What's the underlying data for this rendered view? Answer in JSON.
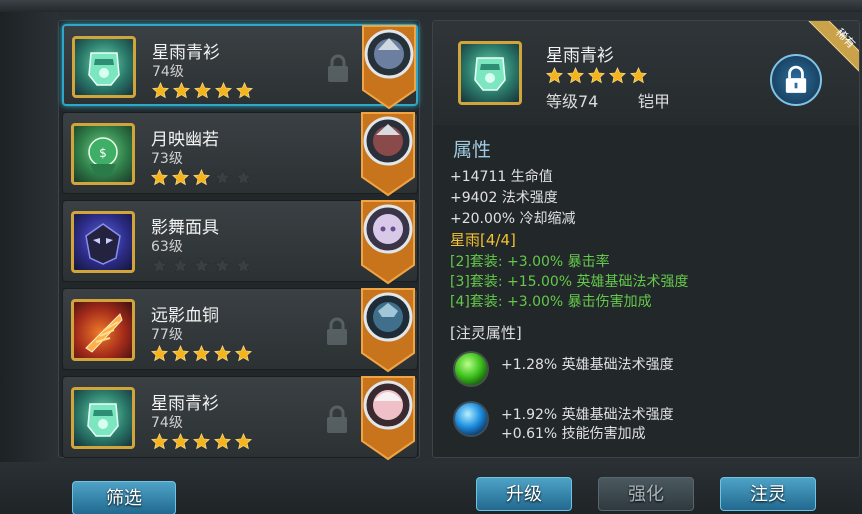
{
  "list": {
    "items": [
      {
        "name": "星雨青衫",
        "level": "74级",
        "stars": 5
      },
      {
        "name": "月映幽若",
        "level": "73级",
        "stars": 3
      },
      {
        "name": "影舞面具",
        "level": "63级",
        "stars": 0
      },
      {
        "name": "远影血铜",
        "level": "77级",
        "stars": 5
      },
      {
        "name": "星雨青衫",
        "level": "74级",
        "stars": 5
      }
    ],
    "filter_button": "筛选"
  },
  "detail": {
    "name": "星雨青衫",
    "stars": 5,
    "level": "等级74",
    "type": "铠甲",
    "ribbon": "稀有",
    "attributes_title": "属性",
    "stats": [
      "+14711 生命值",
      "+9402 法术强度",
      "+20.00% 冷却缩减"
    ],
    "set_title": "星雨[4/4]",
    "set_bonuses": [
      "[2]套装: +3.00% 暴击率",
      "[3]套装: +15.00% 英雄基础法术强度",
      "[4]套装: +3.00% 暴击伤害加成"
    ],
    "spirit_title": "[注灵属性]",
    "spirit_green": "+1.28% 英雄基础法术强度",
    "spirit_blue": [
      "+1.92% 英雄基础法术强度",
      "+0.61% 技能伤害加成"
    ]
  },
  "actions": {
    "upgrade": "升级",
    "enhance": "强化",
    "infuse": "注灵"
  },
  "colors": {
    "accent": "#2fa7c7",
    "gold": "#d2a53a",
    "set_green": "#64c94a",
    "set_title": "#f2c230"
  }
}
